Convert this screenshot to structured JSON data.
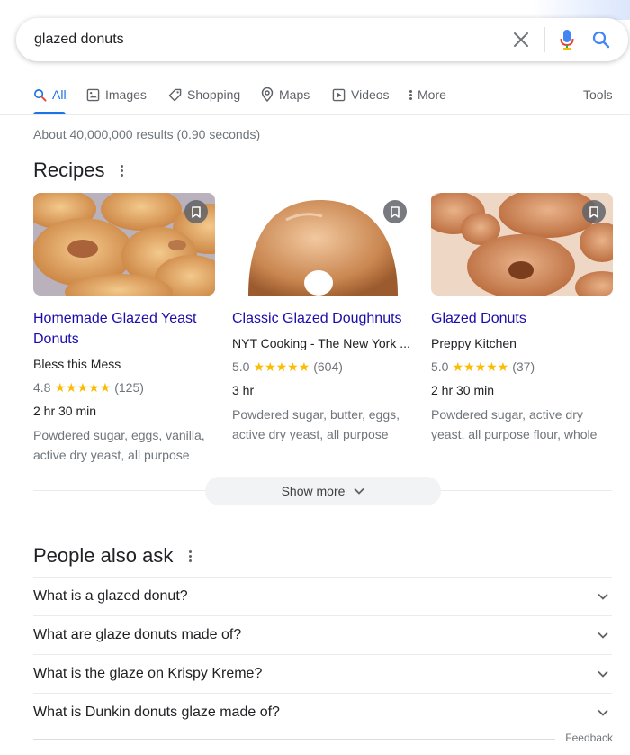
{
  "search": {
    "query": "glazed donuts"
  },
  "tabs": {
    "all": "All",
    "images": "Images",
    "shopping": "Shopping",
    "maps": "Maps",
    "videos": "Videos",
    "more": "More",
    "tools": "Tools"
  },
  "stats": "About 40,000,000 results (0.90 seconds)",
  "recipes": {
    "title": "Recipes",
    "cards": [
      {
        "title": "Homemade Glazed Yeast Donuts",
        "source": "Bless this Mess",
        "rating": "4.8",
        "stars": "★★★★★",
        "reviews": "(125)",
        "time": "2 hr 30 min",
        "ingredients": "Powdered sugar, eggs, vanilla, active dry yeast, all purpose"
      },
      {
        "title": "Classic Glazed Doughnuts",
        "source": "NYT Cooking - The New York ...",
        "rating": "5.0",
        "stars": "★★★★★",
        "reviews": "(604)",
        "time": "3 hr",
        "ingredients": "Powdered sugar, butter, eggs, active dry yeast, all purpose"
      },
      {
        "title": "Glazed Donuts",
        "source": "Preppy Kitchen",
        "rating": "5.0",
        "stars": "★★★★★",
        "reviews": "(37)",
        "time": "2 hr 30 min",
        "ingredients": "Powdered sugar, active dry yeast, all purpose flour, whole"
      }
    ],
    "show_more": "Show more"
  },
  "people_also_ask": {
    "title": "People also ask",
    "questions": [
      "What is a glazed donut?",
      "What are glaze donuts made of?",
      "What is the glaze on Krispy Kreme?",
      "What is Dunkin donuts glaze made of?"
    ]
  },
  "feedback": "Feedback",
  "colors": {
    "link": "#1a0dab",
    "accent": "#1a73e8",
    "star": "#fbbc04",
    "muted": "#70757a"
  },
  "icons": [
    "clear-icon",
    "mic-icon",
    "search-icon",
    "bookmark-icon",
    "chevron-down-icon",
    "more-vert-icon"
  ]
}
